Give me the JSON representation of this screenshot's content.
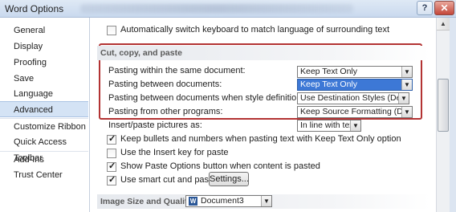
{
  "window": {
    "title": "Word Options",
    "help_label": "?",
    "close_label": "✕"
  },
  "sidebar": {
    "items": [
      {
        "label": "General"
      },
      {
        "label": "Display"
      },
      {
        "label": "Proofing"
      },
      {
        "label": "Save"
      },
      {
        "label": "Language"
      },
      {
        "label": "Advanced",
        "active": true
      },
      {
        "label": "Customize Ribbon"
      },
      {
        "label": "Quick Access Toolbar"
      },
      {
        "label": "Add-Ins"
      },
      {
        "label": "Trust Center"
      }
    ]
  },
  "content": {
    "auto_keyboard": {
      "label": "Automatically switch keyboard to match language of surrounding text",
      "checked": false
    },
    "section_cut_copy_paste": "Cut, copy, and paste",
    "paste_within": {
      "label": "Pasting within the same document:",
      "value": "Keep Text Only"
    },
    "paste_between": {
      "label": "Pasting between documents:",
      "value": "Keep Text Only"
    },
    "paste_conflict": {
      "label": "Pasting between documents when style definitions conflict:",
      "value": "Use Destination Styles (Default)"
    },
    "paste_other": {
      "label": "Pasting from other programs:",
      "value": "Keep Source Formatting (Default)"
    },
    "insert_pictures": {
      "label": "Insert/paste pictures as:",
      "value": "In line with text"
    },
    "keep_bullets": {
      "label": "Keep bullets and numbers when pasting text with Keep Text Only option",
      "checked": true
    },
    "use_insert_key": {
      "label": "Use the Insert key for paste",
      "checked": false
    },
    "show_paste_options": {
      "label": "Show Paste Options button when content is pasted",
      "checked": true
    },
    "smart_cut": {
      "label": "Use smart cut and paste",
      "checked": true
    },
    "settings_button": "Settings...",
    "section_image": "Image Size and Quality",
    "image_document": "Document3"
  },
  "colors": {
    "highlight_box": "#b33333",
    "selected_dropdown": "#3d78d6"
  }
}
